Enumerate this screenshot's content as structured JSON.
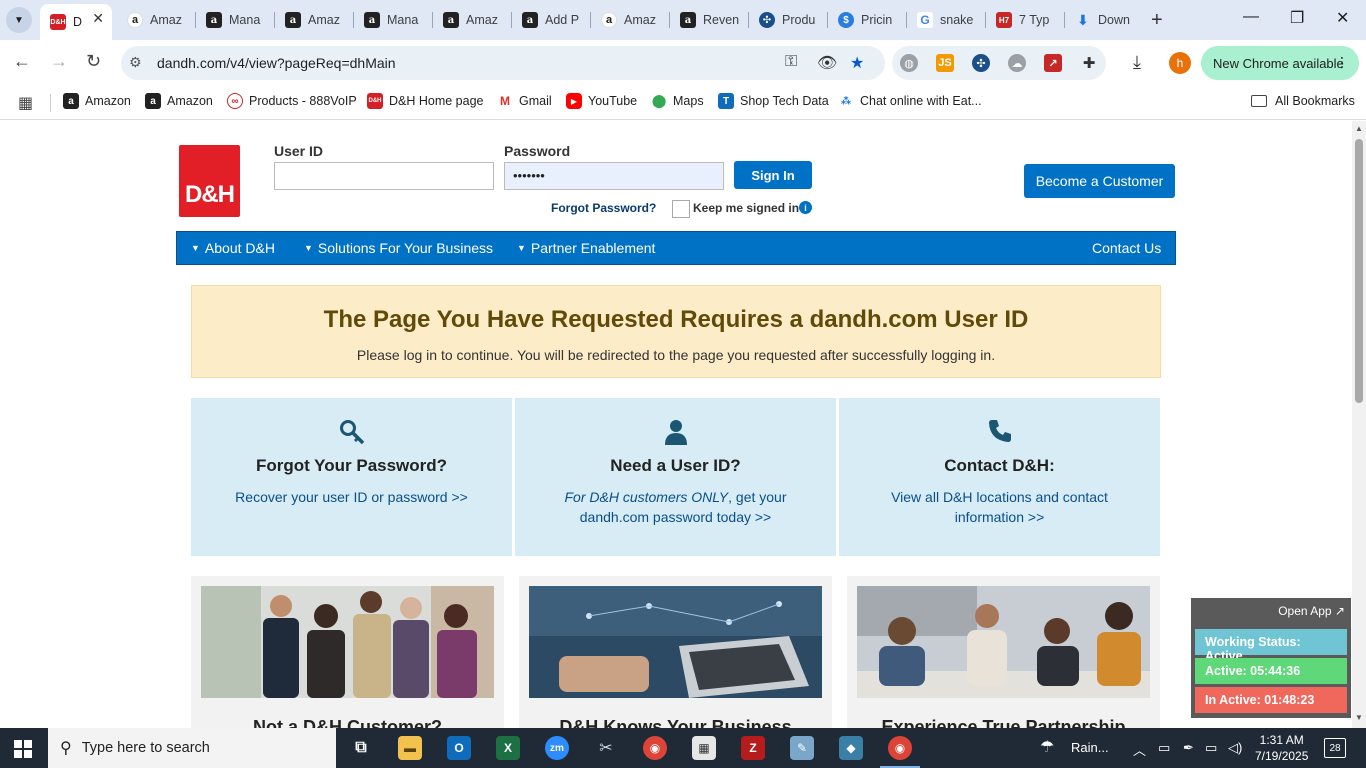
{
  "tabs": [
    {
      "label": "D",
      "icon": "dh-favicon",
      "active": true
    },
    {
      "label": "Amaz",
      "icon": "amazon-favicon"
    },
    {
      "label": "Mana",
      "icon": "amazon-favicon"
    },
    {
      "label": "Amaz",
      "icon": "amazon-favicon"
    },
    {
      "label": "Mana",
      "icon": "amazon-favicon"
    },
    {
      "label": "Amaz",
      "icon": "amazon-favicon"
    },
    {
      "label": "Add P",
      "icon": "amazon-favicon"
    },
    {
      "label": "Amaz",
      "icon": "amazon-smile-favicon"
    },
    {
      "label": "Reven",
      "icon": "amazon-favicon"
    },
    {
      "label": "Produ",
      "icon": "globe-favicon"
    },
    {
      "label": "Pricin",
      "icon": "dollar-favicon"
    },
    {
      "label": "snake",
      "icon": "google-favicon"
    },
    {
      "label": "7 Typ",
      "icon": "h7-favicon"
    },
    {
      "label": "Down",
      "icon": "download-favicon"
    }
  ],
  "omnibox": {
    "url": "dandh.com/v4/view?pageReq=dhMain"
  },
  "update_button": "New Chrome available",
  "profile_initial": "h",
  "bookmarks": [
    {
      "label": "Amazon",
      "icon": "amazon-favicon"
    },
    {
      "label": "Amazon",
      "icon": "amazon-favicon"
    },
    {
      "label": "Products - 888VoIP",
      "icon": "voip-favicon"
    },
    {
      "label": "D&H Home page",
      "icon": "dh-favicon"
    },
    {
      "label": "Gmail",
      "icon": "gmail-favicon"
    },
    {
      "label": "YouTube",
      "icon": "youtube-favicon"
    },
    {
      "label": "Maps",
      "icon": "maps-favicon"
    },
    {
      "label": "Shop Tech Data",
      "icon": "techdata-favicon"
    },
    {
      "label": "Chat online with Eat...",
      "icon": "chat-favicon"
    }
  ],
  "all_bookmarks": "All Bookmarks",
  "site": {
    "logo": "D&H",
    "login": {
      "user_id_label": "User ID",
      "user_id_value": "",
      "password_label": "Password",
      "password_value": "•••••••",
      "sign_in": "Sign In",
      "forgot_password": "Forgot Password?",
      "keep_signed_in": "Keep me signed in"
    },
    "become_customer": "Become a Customer",
    "nav": {
      "items": [
        "About D&H",
        "Solutions For Your Business",
        "Partner Enablement"
      ],
      "contact": "Contact Us"
    },
    "alert": {
      "title": "The Page You Have Requested Requires a dandh.com User ID",
      "message": "Please log in to continue. You will be redirected to the page you requested after successfully logging in."
    },
    "cards": [
      {
        "title": "Forgot Your Password?",
        "link": "Recover your user ID or password >>",
        "icon": "key-search-icon"
      },
      {
        "title": "Need a User ID?",
        "link_em": "For D&H customers ONLY",
        "link": ", get your dandh.com password today >>",
        "icon": "user-icon"
      },
      {
        "title": "Contact D&H:",
        "link": "View all D&H locations and contact information >>",
        "icon": "phone-icon"
      }
    ],
    "promos": [
      {
        "title": "Not a D&H Customer?"
      },
      {
        "title": "D&H Knows Your Business"
      },
      {
        "title": "Experience True Partnership"
      }
    ]
  },
  "status_widget": {
    "open_app": "Open App ↗",
    "working_status": "Working Status: Active",
    "active": "Active: 05:44:36",
    "inactive": "In Active: 01:48:23",
    "colors": {
      "working": "#6fc5d3",
      "active": "#5fd87a",
      "inactive": "#f0685c"
    }
  },
  "taskbar": {
    "search_placeholder": "Type here to search",
    "weather": "Rain...",
    "time": "1:31 AM",
    "date": "7/19/2025",
    "notifications": "28"
  }
}
